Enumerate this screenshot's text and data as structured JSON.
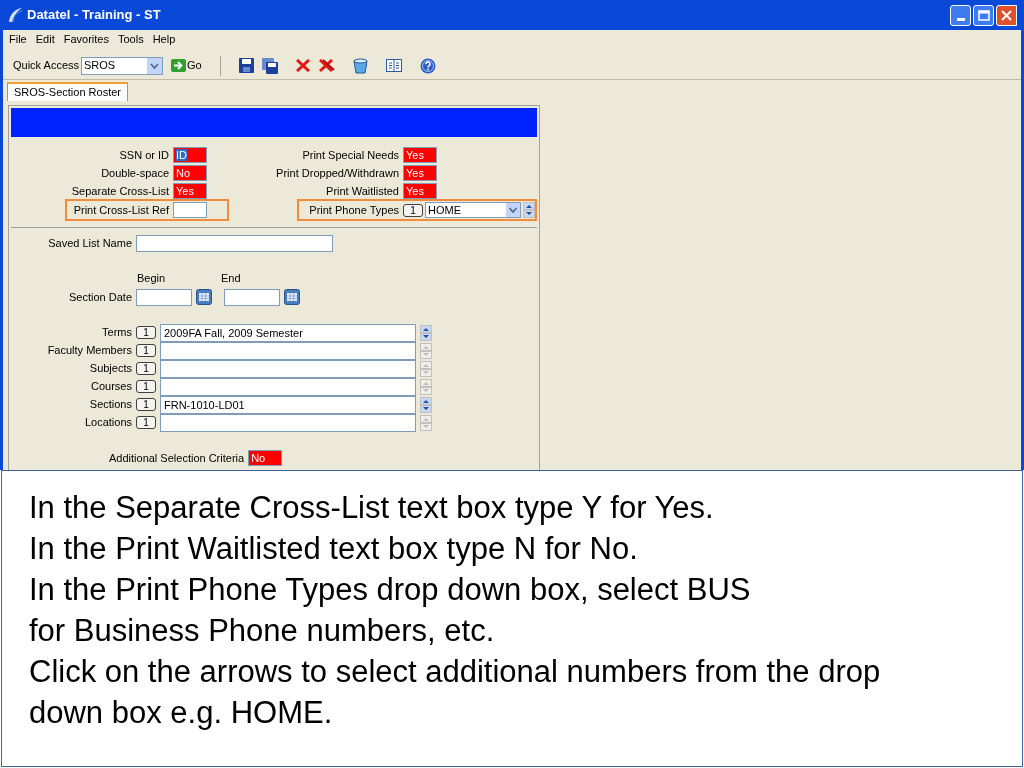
{
  "window": {
    "title": "Datatel - Training - ST"
  },
  "menu": [
    "File",
    "Edit",
    "Favorites",
    "Tools",
    "Help"
  ],
  "toolbar": {
    "quick_access_label": "Quick Access",
    "quick_access_value": "SROS",
    "go_label": "Go"
  },
  "tabs": [
    {
      "label": "SROS-Section Roster",
      "selected": true
    }
  ],
  "left_flags": [
    {
      "label": "SSN or ID",
      "value": "ID",
      "highlighted": false
    },
    {
      "label": "Double-space",
      "value": "No",
      "highlighted": false
    },
    {
      "label": "Separate Cross-List",
      "value": "Yes",
      "highlighted": false
    },
    {
      "label": "Print Cross-List Ref",
      "highlighted": true
    }
  ],
  "right_flags": [
    {
      "label": "Print Special Needs",
      "value": "Yes"
    },
    {
      "label": "Print Dropped/Withdrawn",
      "value": "Yes"
    },
    {
      "label": "Print Waitlisted",
      "value": "Yes"
    }
  ],
  "phone_types": {
    "label": "Print Phone Types",
    "index": "1",
    "value": "HOME",
    "highlighted": true
  },
  "saved_list_name": {
    "label": "Saved List Name"
  },
  "section_date": {
    "label": "Section Date",
    "begin_label": "Begin",
    "end_label": "End"
  },
  "lists": [
    {
      "label": "Terms",
      "index": "1",
      "value": "2009FA Fall, 2009 Semester",
      "scroll_enabled": true
    },
    {
      "label": "Faculty Members",
      "index": "1",
      "scroll_enabled": false
    },
    {
      "label": "Subjects",
      "index": "1",
      "scroll_enabled": false
    },
    {
      "label": "Courses",
      "index": "1",
      "scroll_enabled": false
    },
    {
      "label": "Sections",
      "index": "1",
      "value": "FRN-1010-LD01",
      "scroll_enabled": true
    },
    {
      "label": "Locations",
      "index": "1",
      "scroll_enabled": false
    }
  ],
  "additional_criteria": {
    "label": "Additional Selection Criteria",
    "value": "No"
  },
  "caption": [
    "In the Separate Cross-List text box type Y for Yes.",
    "In the Print Waitlisted text box type N for No.",
    "In the Print Phone Types drop down box, select BUS",
    "for Business Phone numbers, etc.",
    "Click on the arrows to select additional numbers from the drop down box e.g. HOME."
  ]
}
